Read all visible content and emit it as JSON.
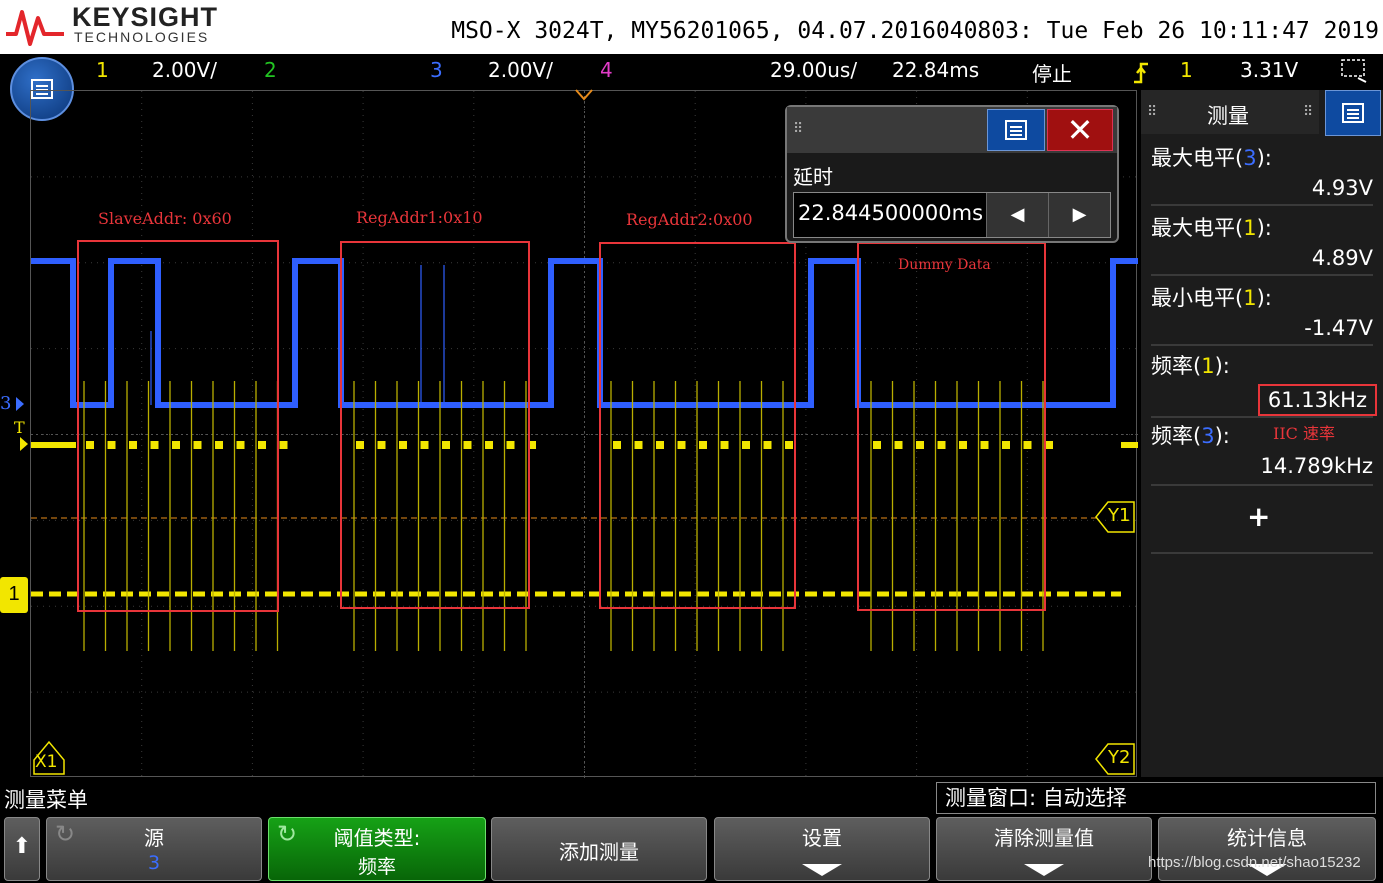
{
  "title_bar": {
    "brand_name": "KEYSIGHT",
    "brand_sub": "TECHNOLOGIES",
    "device_line": "MSO-X 3024T, MY56201065, 04.07.2016040803: Tue Feb 26 10:11:47 2019"
  },
  "status_bar": {
    "ch1_num": "1",
    "ch1_scale": "2.00V/",
    "ch2_num": "2",
    "ch3_num": "3",
    "ch3_scale": "2.00V/",
    "ch4_num": "4",
    "timebase": "29.00us/",
    "delay": "22.84ms",
    "run_state": "停止",
    "trigger_source": "1",
    "trigger_level": "3.31V"
  },
  "annotations": {
    "slave_addr": "SlaveAddr: 0x60",
    "reg_addr1": "RegAddr1:0x10",
    "reg_addr2": "RegAddr2:0x00",
    "dummy_data": "Dummy Data",
    "iic_rate": "IIC 速率"
  },
  "markers": {
    "ch3": "3",
    "ch1": "1",
    "trigger": "T",
    "x1": "X1",
    "y1": "Y1",
    "y2": "Y2"
  },
  "delay_popup": {
    "label": "延时",
    "value": "22.844500000ms"
  },
  "measure_panel": {
    "title": "测量",
    "items": [
      {
        "label": "最大电平",
        "ch": "3",
        "value": "4.93V"
      },
      {
        "label": "最大电平",
        "ch": "1",
        "value": "4.89V"
      },
      {
        "label": "最小电平",
        "ch": "1",
        "value": "-1.47V"
      },
      {
        "label": "频率",
        "ch": "1",
        "value": "61.13kHz"
      },
      {
        "label": "频率",
        "ch": "3",
        "value": "14.789kHz"
      }
    ],
    "add_symbol": "+"
  },
  "bottom": {
    "menu_title": "测量菜单",
    "window_info": "测量窗口: 自动选择",
    "softkeys": {
      "source_label": "源",
      "source_value": "3",
      "threshold_label": "阈值类型:",
      "threshold_value": "频率",
      "add_measure": "添加测量",
      "settings": "设置",
      "clear": "清除测量值",
      "stats": "统计信息"
    },
    "watermark": "https://blog.csdn.net/shao15232"
  },
  "colors": {
    "ch1": "#f2e600",
    "ch3": "#3b6dff",
    "ch4": "#e23cc8",
    "ch2": "#22c422",
    "annotation_red": "#e8353a",
    "softkey_green": "#0a8a0a"
  }
}
